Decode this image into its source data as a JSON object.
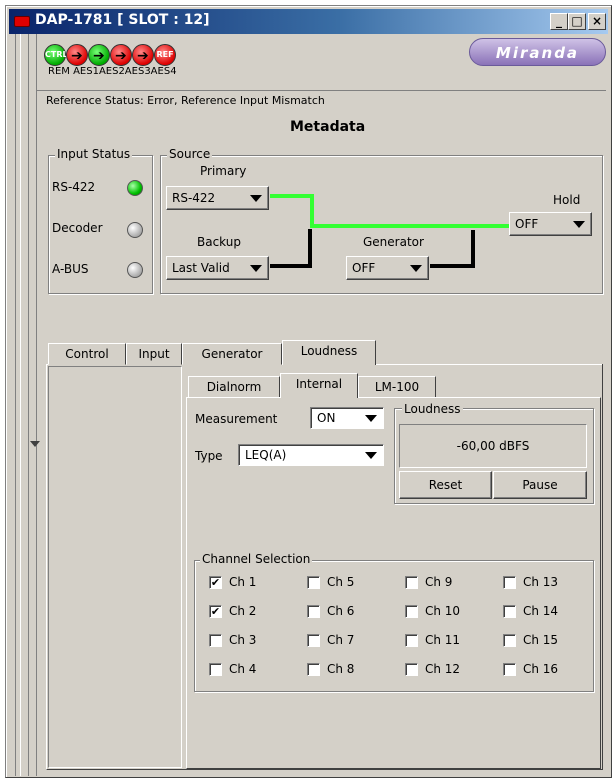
{
  "window": {
    "title": "DAP-1781 [ SLOT : 12]",
    "minimize": "_",
    "maximize": "□",
    "close": "×"
  },
  "status_icons": [
    {
      "label": "CTRL",
      "kind": "green-circle"
    },
    {
      "label": "",
      "kind": "red-arrow"
    },
    {
      "label": "",
      "kind": "green-arrow"
    },
    {
      "label": "",
      "kind": "red-arrow"
    },
    {
      "label": "",
      "kind": "red-arrow"
    },
    {
      "label": "REF",
      "kind": "red-circle"
    }
  ],
  "status_labels": "REM AES1AES2AES3AES4",
  "logo": "Miranda",
  "reference_status": "Reference Status: Error, Reference Input Mismatch",
  "heading": "Metadata",
  "input_status": {
    "title": "Input Status",
    "items": [
      {
        "label": "RS-422",
        "state": "green"
      },
      {
        "label": "Decoder",
        "state": "grey"
      },
      {
        "label": "A-BUS",
        "state": "grey"
      }
    ]
  },
  "source": {
    "title": "Source",
    "primary_label": "Primary",
    "primary_value": "RS-422",
    "backup_label": "Backup",
    "backup_value": "Last Valid",
    "generator_label": "Generator",
    "generator_value": "OFF",
    "hold_label": "Hold",
    "hold_value": "OFF"
  },
  "main_tabs": [
    "Control",
    "Input",
    "Generator",
    "Loudness"
  ],
  "active_main_tab": "Loudness",
  "sub_tabs": [
    "Dialnorm",
    "Internal",
    "LM-100"
  ],
  "active_sub_tab": "Internal",
  "measurement": {
    "label": "Measurement",
    "value": "ON"
  },
  "type": {
    "label": "Type",
    "value": "LEQ(A)"
  },
  "loudness": {
    "title": "Loudness",
    "reading": "-60,00 dBFS",
    "reset": "Reset",
    "pause": "Pause"
  },
  "channel_selection": {
    "title": "Channel Selection",
    "channels": [
      {
        "label": "Ch 1",
        "checked": true
      },
      {
        "label": "Ch 2",
        "checked": true
      },
      {
        "label": "Ch 3",
        "checked": false
      },
      {
        "label": "Ch 4",
        "checked": false
      },
      {
        "label": "Ch 5",
        "checked": false
      },
      {
        "label": "Ch 6",
        "checked": false
      },
      {
        "label": "Ch 7",
        "checked": false
      },
      {
        "label": "Ch 8",
        "checked": false
      },
      {
        "label": "Ch 9",
        "checked": false
      },
      {
        "label": "Ch 10",
        "checked": false
      },
      {
        "label": "Ch 11",
        "checked": false
      },
      {
        "label": "Ch 12",
        "checked": false
      },
      {
        "label": "Ch 13",
        "checked": false
      },
      {
        "label": "Ch 14",
        "checked": false
      },
      {
        "label": "Ch 15",
        "checked": false
      },
      {
        "label": "Ch 16",
        "checked": false
      }
    ]
  }
}
